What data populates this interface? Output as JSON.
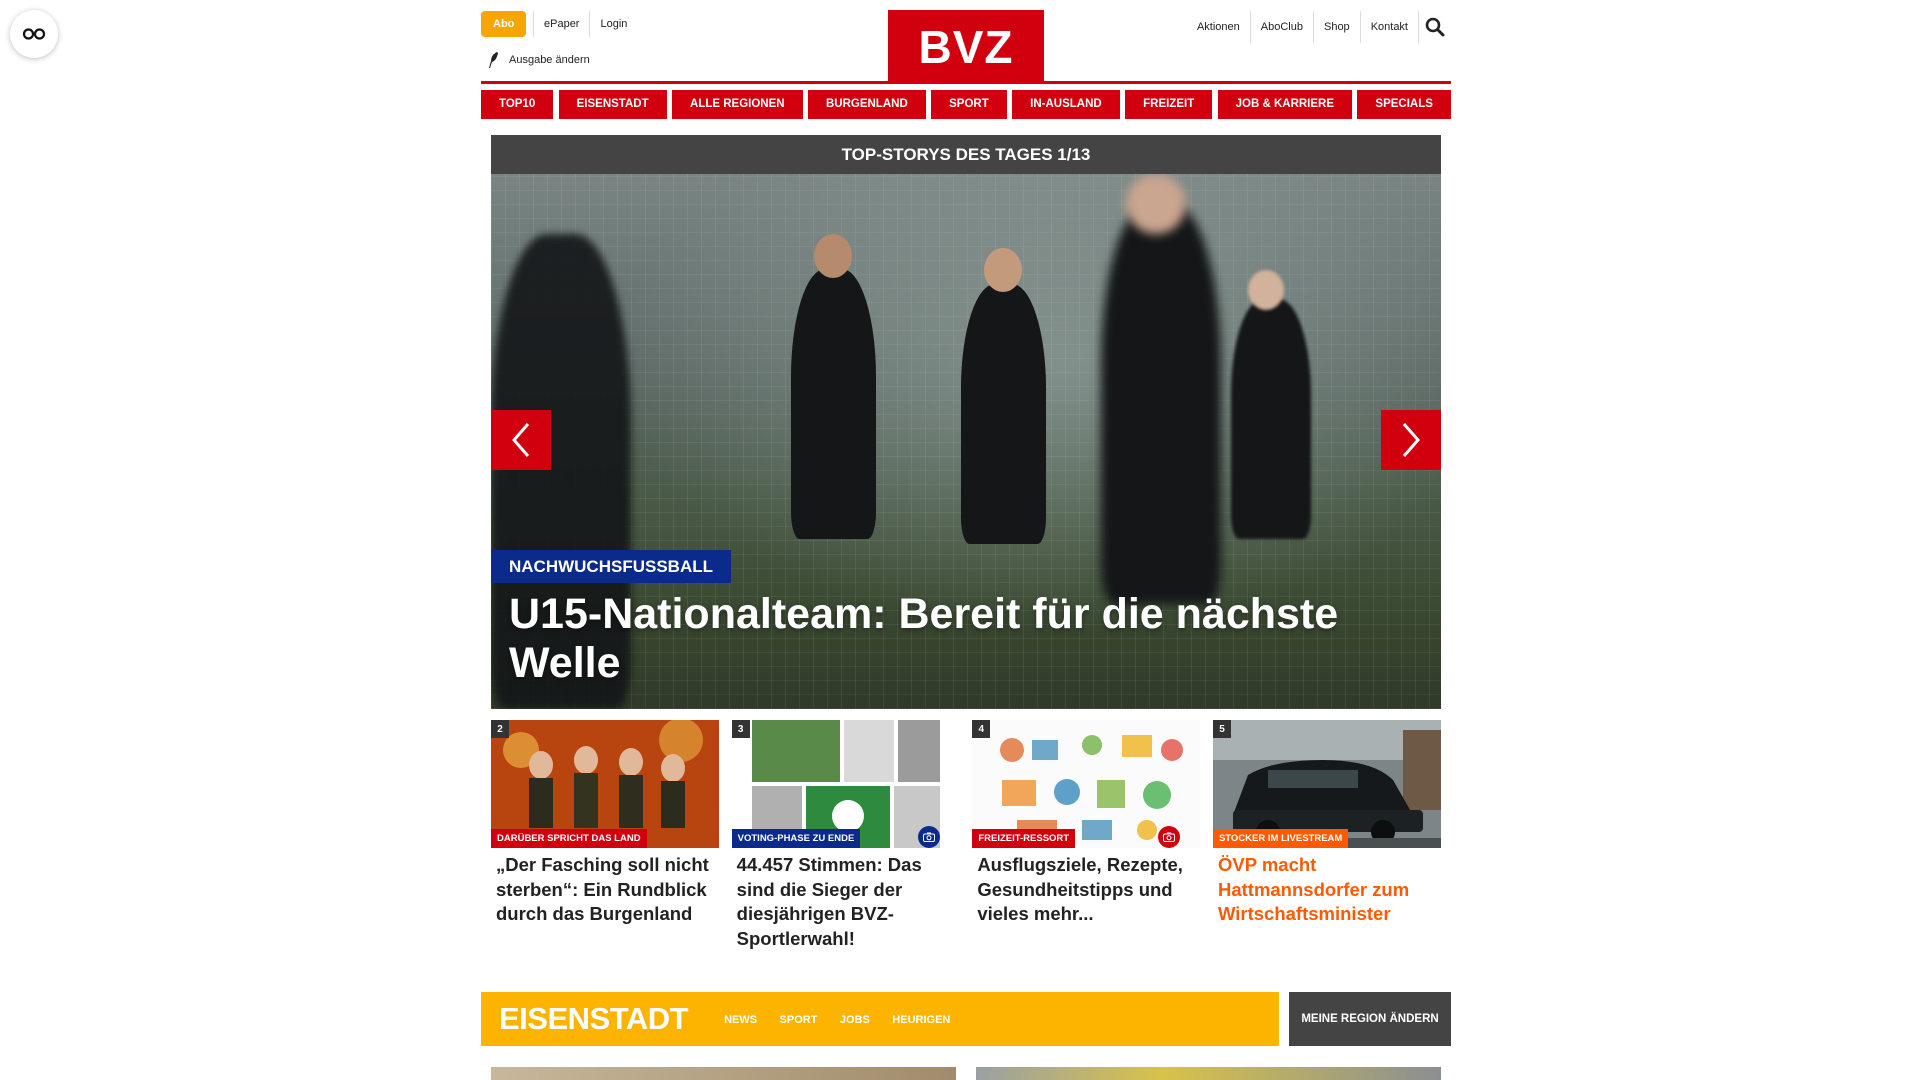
{
  "header": {
    "abo_label": "Abo",
    "epaper_label": "ePaper",
    "login_label": "Login",
    "edition_label": "Ausgabe ändern",
    "logo_text": "BVZ",
    "right_links": [
      "Aktionen",
      "AboClub",
      "Shop",
      "Kontakt"
    ]
  },
  "nav": {
    "items": [
      "TOP10",
      "EISENSTADT",
      "ALLE REGIONEN",
      "BURGENLAND",
      "SPORT",
      "IN-AUSLAND",
      "FREIZEIT",
      "JOB & KARRIERE",
      "SPECIALS"
    ]
  },
  "slider": {
    "header": "TOP-STORYS DES TAGES 1/13",
    "category": "NACHWUCHSFUSSBALL",
    "headline": "U15-Nationalteam: Bereit für die nächste Welle"
  },
  "teasers": [
    {
      "number": "2",
      "label": "DARÜBER SPRICHT DAS LAND",
      "label_color": "#d0000f",
      "title": "„Der Fasching soll nicht sterben“: Ein Rundblick durch das Burgenland",
      "has_camera": false
    },
    {
      "number": "3",
      "label": "VOTING-PHASE ZU ENDE",
      "label_color": "#0b2b8c",
      "title": "44.457 Stimmen: Das sind die Sieger der diesjährigen BVZ-Sportlerwahl!",
      "has_camera": true,
      "camera_color": "#0b2b8c"
    },
    {
      "number": "4",
      "label": "FREIZEIT-RESSORT",
      "label_color": "#d0000f",
      "title": "Ausflugsziele, Rezepte, Gesundheitstipps und vieles mehr...",
      "has_camera": true,
      "camera_color": "#d0000f"
    },
    {
      "number": "5",
      "label": "STOCKER IM LIVESTREAM",
      "label_color": "#ff5a00",
      "title": "ÖVP macht Hattmannsdorfer zum Wirtschaftsminister",
      "has_camera": false,
      "title_highlight": true
    }
  ],
  "region": {
    "title": "EISENSTADT",
    "links": [
      "NEWS",
      "SPORT",
      "JOBS",
      "HEURIGEN"
    ],
    "change_button": "MEINE REGION ÄNDERN"
  },
  "colors": {
    "brand_red": "#d0000f",
    "abo_orange": "#f7a500",
    "region_yellow": "#fcb400",
    "category_blue": "#0b2b8c",
    "highlight_orange": "#ff5a00"
  }
}
